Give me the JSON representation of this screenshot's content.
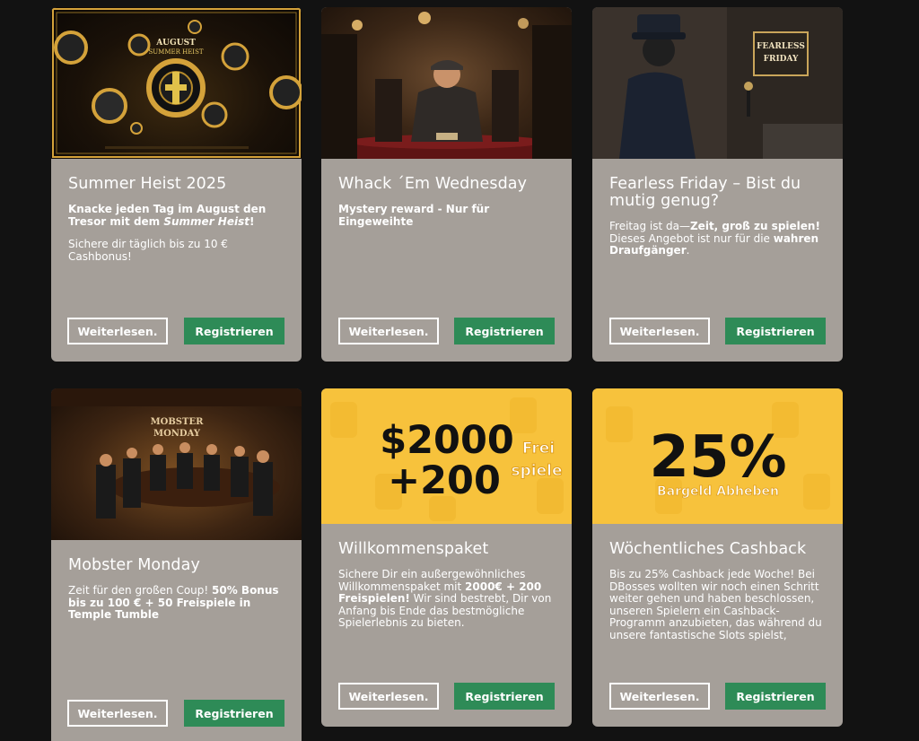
{
  "cards": [
    {
      "title": "Summer Heist 2025",
      "sub_part1": "Knacke jeden Tag im August den Tresor mit dem ",
      "sub_em": "Summer Heist",
      "sub_part2": "!",
      "desc": "Sichere dir täglich bis zu 10 € Cashbonus!",
      "image_text_1": "AUGUST",
      "image_text_2": "SUMMER HEIST",
      "image_icon": "casino-chips-icon",
      "more_label": "Weiterlesen.",
      "register_label": "Registrieren"
    },
    {
      "title": "Whack ´Em Wednesday",
      "sub": "Mystery reward - Nur für Eingeweihte",
      "image_icon": "poker-table-icon",
      "more_label": "Weiterlesen.",
      "register_label": "Registrieren"
    },
    {
      "title": "Fearless Friday – Bist du mutig genug?",
      "desc_part1": "Freitag ist da—",
      "desc_bold1": "Zeit, groß zu spielen!",
      "desc_part2": " Dieses Angebot ist nur für die ",
      "desc_bold2": "wahren Draufgänger",
      "desc_part3": ".",
      "image_sign_1": "FEARLESS",
      "image_sign_2": "FRIDAY",
      "more_label": "Weiterlesen.",
      "register_label": "Registrieren"
    },
    {
      "title": "Mobster Monday",
      "desc_part1": " Zeit für den großen Coup! ",
      "desc_bold1": "50% Bonus bis zu 100 € + 50 Freispiele in Temple Tumble",
      "image_text_1": "MOBSTER",
      "image_text_2": "MONDAY",
      "more_label": "Weiterlesen.",
      "register_label": "Registrieren"
    },
    {
      "title": "Willkommenspaket",
      "desc_part1": "Sichere Dir ein außergewöhnliches Willkommenspaket mit ",
      "desc_bold1": "2000€ + 200 Freispielen!",
      "desc_part2": " Wir sind bestrebt, Dir von Anfang bis Ende das bestmögliche Spielerlebnis zu bieten.",
      "banner_big_1": "$2000",
      "banner_big_2": "+200",
      "banner_small_1": "Frei",
      "banner_small_2": "spiele",
      "more_label": "Weiterlesen.",
      "register_label": "Registrieren"
    },
    {
      "title": "Wöchentliches Cashback",
      "desc": "Bis zu 25% Cashback jede Woche! Bei DBosses wollten wir noch einen Schritt weiter gehen und haben beschlossen, unseren Spielern ein Cashback-Programm anzubieten, das während du unsere fantastische Slots spielst, wächst.",
      "banner_big": "25%",
      "banner_small": "Bargeld Abheben",
      "more_label": "Weiterlesen.",
      "register_label": "Registrieren"
    }
  ],
  "colors": {
    "page_bg": "#121212",
    "card_bg": "#a59f99",
    "green": "#2e8b57",
    "yellow": "#f7c23c",
    "gold": "#d4a23a"
  }
}
